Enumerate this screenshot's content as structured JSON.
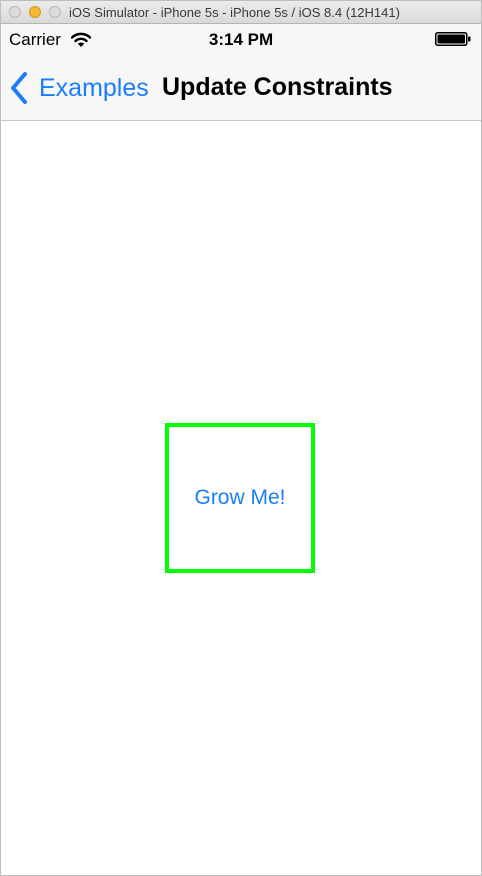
{
  "window": {
    "title": "iOS Simulator - iPhone 5s - iPhone 5s / iOS 8.4 (12H141)"
  },
  "status_bar": {
    "carrier": "Carrier",
    "time": "3:14 PM",
    "wifi_icon": "wifi-icon",
    "battery_icon": "battery-full-icon"
  },
  "nav_bar": {
    "back_label": "Examples",
    "back_icon": "chevron-left-icon",
    "title": "Update Constraints"
  },
  "content": {
    "grow_button_label": "Grow Me!",
    "border_color": "#00ff00",
    "tint_color": "#1a7efb"
  }
}
